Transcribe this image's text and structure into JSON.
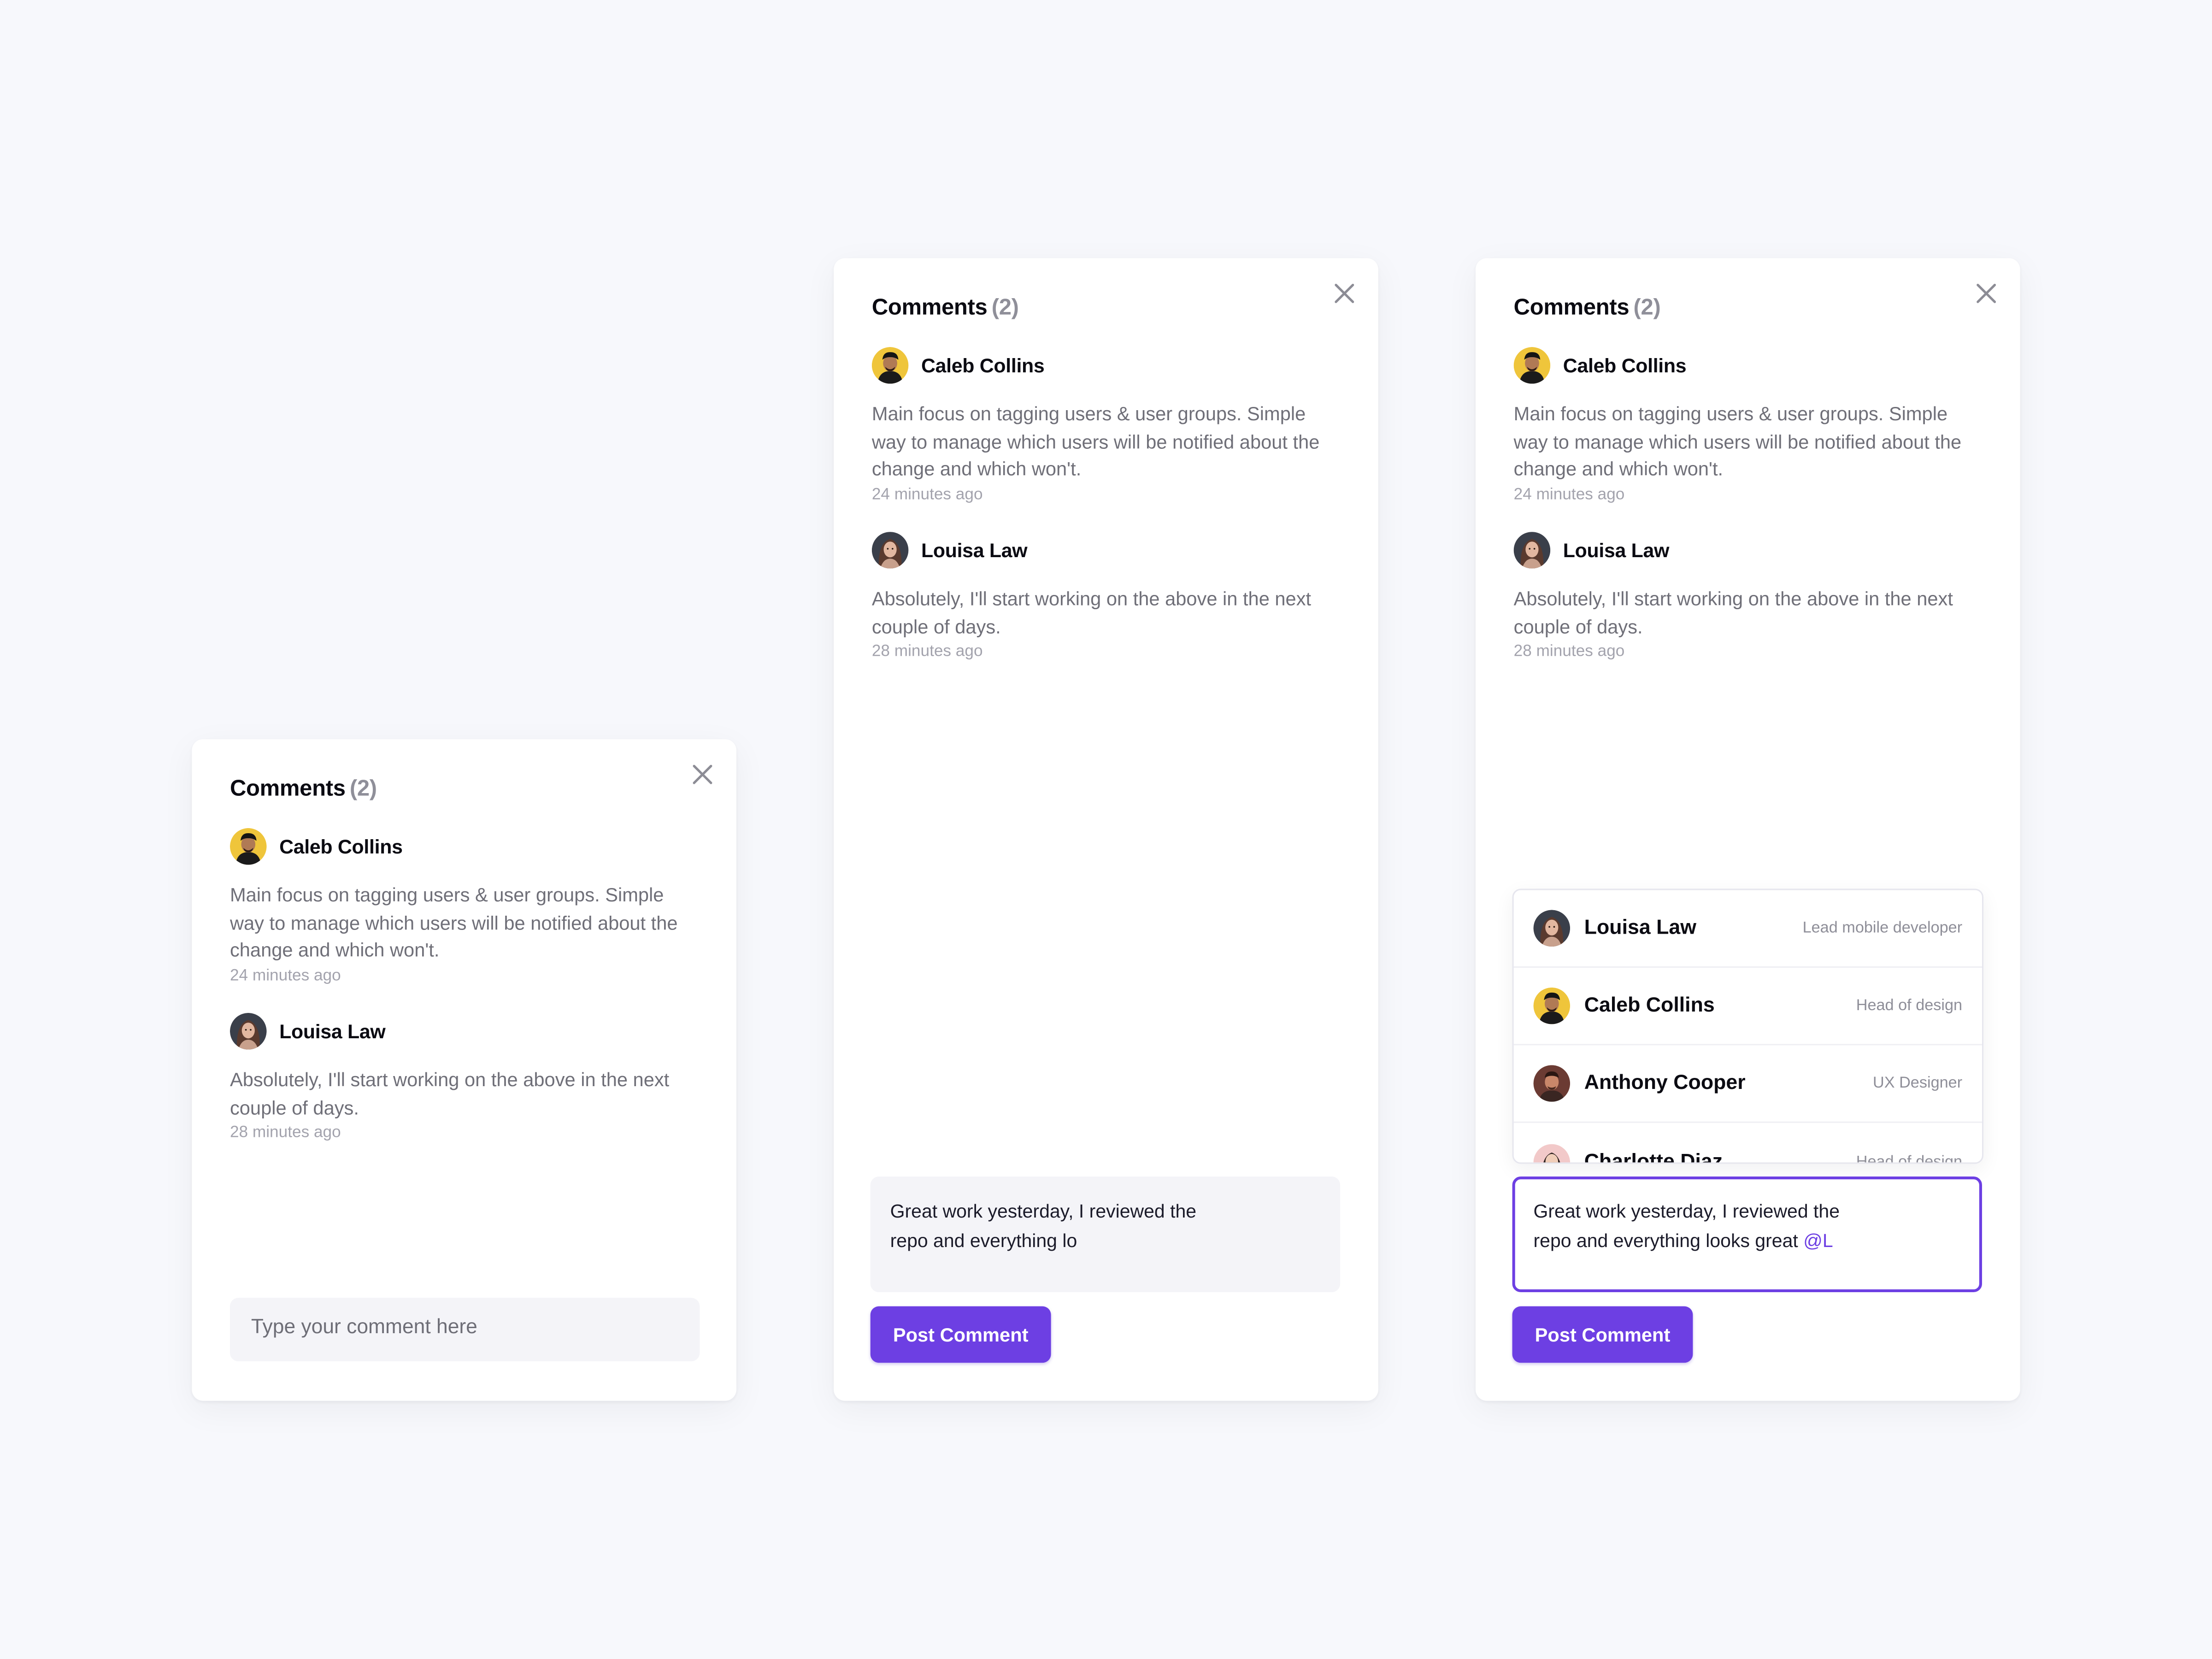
{
  "colors": {
    "background": "#f7f8fc",
    "accent": "#6d3fe3",
    "muted_text": "#6f6f78",
    "timestamp": "#a3a3ad"
  },
  "panel": {
    "title": "Comments",
    "count": "(2)",
    "close_icon": "close-icon"
  },
  "comments": [
    {
      "author": "Caleb Collins",
      "avatar_icon": "caleb-avatar",
      "text": "Main focus on tagging users & user groups. Simple way to manage which users will be notified about the change and which won't.",
      "time": "24 minutes ago"
    },
    {
      "author": "Louisa Law",
      "avatar_icon": "louisa-avatar",
      "text": "Absolutely, I'll start working on the above in the next couple of days.",
      "time": "28 minutes ago"
    }
  ],
  "composer_empty": {
    "placeholder": "Type your comment here"
  },
  "composer_typing": {
    "line1": "Great work yesterday, I reviewed the",
    "line2": "repo and everything lo"
  },
  "composer_mention": {
    "line1": "Great work yesterday, I reviewed the",
    "line2": "repo and everything looks great",
    "mention": "@L"
  },
  "post_button": "Post Comment",
  "mention_suggestions": [
    {
      "name": "Louisa Law",
      "role": "Lead mobile developer",
      "avatar_icon": "louisa-avatar"
    },
    {
      "name": "Caleb Collins",
      "role": "Head of design",
      "avatar_icon": "caleb-avatar"
    },
    {
      "name": "Anthony Cooper",
      "role": "UX Designer",
      "avatar_icon": "anthony-avatar"
    },
    {
      "name": "Charlotte Diaz",
      "role": "Head of design",
      "avatar_icon": "charlotte-avatar"
    }
  ]
}
